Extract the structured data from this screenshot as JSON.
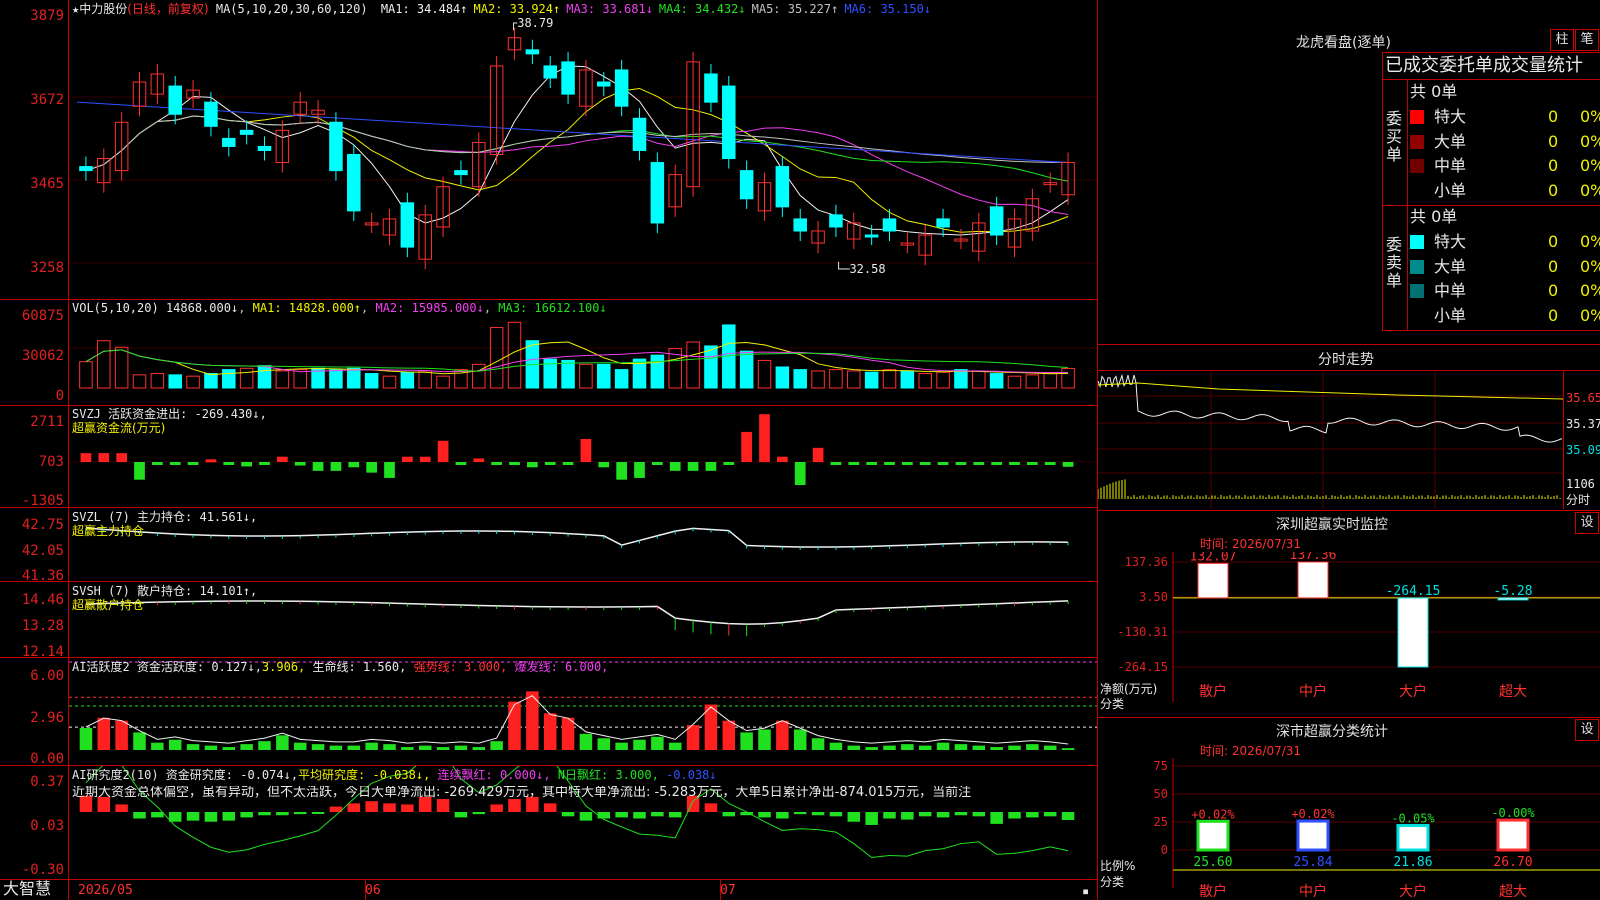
{
  "app": {
    "brand": "大智慧",
    "star": "★",
    "timeline": [
      "2026/05",
      "06",
      "07"
    ]
  },
  "kline": {
    "stock": "中力股份",
    "mode": "(日线，前复权)",
    "ma_def": "MA(5,10,20,30,60,120)",
    "ma_values": [
      {
        "label": "MA1:",
        "value": "34.484↑",
        "color": "#f0f0f0"
      },
      {
        "label": "MA2:",
        "value": "33.924↑",
        "color": "#f0f000"
      },
      {
        "label": "MA3:",
        "value": "33.681↓",
        "color": "#f040f0"
      },
      {
        "label": "MA4:",
        "value": "34.432↓",
        "color": "#20e020"
      },
      {
        "label": "MA5:",
        "value": "35.227↑",
        "color": "#c0c0c0"
      },
      {
        "label": "MA6:",
        "value": "35.150↓",
        "color": "#3050ff"
      }
    ],
    "y_ticks": [
      "3879",
      "3672",
      "3465",
      "3258"
    ],
    "high_mark": "38.79",
    "low_mark": "32.58"
  },
  "vol": {
    "title": "VOL(5,10,20)",
    "value": "14868.000↓",
    "ma1": "14828.000↑",
    "ma2": "15985.000↓",
    "ma3": "16612.100↓",
    "y_ticks": [
      "60875",
      "30062",
      "0"
    ]
  },
  "svzj": {
    "title": "SVZJ  活跃资金进出: -269.430↓,",
    "sub": "超赢资金流(万元)",
    "y_ticks": [
      "2711",
      "703",
      "-1305"
    ]
  },
  "svzl": {
    "title": "SVZL (7) 主力持仓: 41.561↓,",
    "sub": "超赢主力持仓",
    "y_ticks": [
      "42.75",
      "42.05",
      "41.36"
    ]
  },
  "svsh": {
    "title": "SVSH (7) 散户持仓: 14.101↑,",
    "sub": "超赢散户持仓",
    "y_ticks": [
      "14.46",
      "13.28",
      "12.14"
    ]
  },
  "ai2": {
    "title": "AI活跃度2 资金活跃度: 0.127↓,",
    "v2": "3.906,",
    "life": "生命线: 1.560,",
    "strong": "强势线: 3.000,",
    "burst": "爆发线: 6.000,",
    "y_ticks": [
      "6.00",
      "2.96",
      "0.00"
    ]
  },
  "ai_r": {
    "title": "AI研究度2(10) 资金研究度: -0.074↓,",
    "avg": "平均研究度: -0.038↓,",
    "cont": "连续飘红: 0.000↓,",
    "nday": "N日飘红: 3.000,",
    "nday2": "-0.038↓",
    "desc": "近期大资金总体偏空，虽有异动，但不太活跃，今日大单净流出: -269.429万元，其中特大单净流出: -5.283万元，大单5日累计净出-874.015万元，当前注",
    "y_ticks": [
      "0.37",
      "0.03",
      "-0.30"
    ]
  },
  "lhb": {
    "title": "龙虎看盘(逐单)",
    "btn1": "柱",
    "btn2": "笔",
    "header": "已成交委托单成交量统计",
    "buy_label": "委买单",
    "sell_label": "委卖单",
    "buy_total": "共 0单",
    "sell_total": "共 0单",
    "buy_rows": [
      {
        "name": "特大",
        "count": "0",
        "pct": "0%",
        "color": "#ff0000"
      },
      {
        "name": "大单",
        "count": "0",
        "pct": "0%",
        "color": "#900000"
      },
      {
        "name": "中单",
        "count": "0",
        "pct": "0%",
        "color": "#700000"
      },
      {
        "name": "小单",
        "count": "0",
        "pct": "0%",
        "color": "#000000"
      }
    ],
    "sell_rows": [
      {
        "name": "特大",
        "count": "0",
        "pct": "0%",
        "color": "#00ffff"
      },
      {
        "name": "大单",
        "count": "0",
        "pct": "0%",
        "color": "#008b8b"
      },
      {
        "name": "中单",
        "count": "0",
        "pct": "0%",
        "color": "#007070"
      },
      {
        "name": "小单",
        "count": "0",
        "pct": "0%",
        "color": "#000000"
      }
    ]
  },
  "intraday": {
    "title": "分时走势",
    "prices": [
      "35.65",
      "35.37",
      "35.09"
    ],
    "vol_label": "1106",
    "vol_unit": "分时"
  },
  "monitor": {
    "title": "深圳超赢实时监控",
    "btn": "设",
    "time_label": "时间: 2026/07/31",
    "y_ticks": [
      "137.36",
      "3.50",
      "-130.31",
      "-264.15"
    ],
    "y_unit": "净额(万元)",
    "x_unit": "分类",
    "cats": [
      "散户",
      "中户",
      "大户",
      "超大"
    ],
    "values": [
      "132.07",
      "137.36",
      "-264.15",
      "-5.28"
    ]
  },
  "classify": {
    "title": "深市超赢分类统计",
    "btn": "设",
    "time_label": "时间: 2026/07/31",
    "y_ticks": [
      "75",
      "50",
      "25",
      "0"
    ],
    "y_unit": "比例%",
    "x_unit": "分类",
    "cats": [
      "散户",
      "中户",
      "大户",
      "超大"
    ],
    "pcts": [
      "+0.02%",
      "+0.02%",
      "-0.05%",
      "-0.00%"
    ],
    "vals": [
      "25.60",
      "25.84",
      "21.86",
      "26.70"
    ]
  },
  "chart_data": [
    {
      "type": "candlestick",
      "title": "中力股份 (日线，前复权)",
      "y_ticks": [
        3879,
        3672,
        3465,
        3258
      ],
      "close": [
        34.9,
        35.2,
        36.1,
        37.1,
        37.3,
        36.3,
        36.9,
        36.0,
        35.5,
        35.8,
        35.4,
        35.9,
        36.6,
        36.4,
        34.9,
        33.9,
        33.6,
        33.7,
        33.0,
        33.8,
        34.5,
        34.8,
        35.6,
        37.5,
        38.2,
        37.8,
        37.2,
        36.8,
        37.4,
        37.0,
        36.5,
        35.4,
        33.6,
        34.8,
        37.6,
        36.6,
        35.2,
        34.2,
        34.6,
        34.0,
        33.4,
        33.4,
        33.5,
        33.6,
        33.3,
        33.4,
        33.1,
        33.3,
        33.5,
        33.2,
        33.6,
        33.3,
        33.7,
        34.2,
        34.6,
        35.1
      ]
    },
    {
      "type": "bar",
      "title": "VOL(5,10,20)",
      "values": [
        20000,
        36000,
        31000,
        10000,
        11000,
        10000,
        9000,
        11000,
        14000,
        15000,
        17000,
        13000,
        14000,
        15000,
        14000,
        15000,
        11000,
        9000,
        12000,
        13000,
        9000,
        14000,
        18000,
        46000,
        50000,
        36000,
        22000,
        21000,
        18000,
        18000,
        14000,
        22000,
        25000,
        30000,
        35000,
        32000,
        48000,
        28000,
        21000,
        16000,
        14000,
        13000,
        14000,
        13000,
        12000,
        14000,
        13000,
        11000,
        12000,
        14000,
        13000,
        11000,
        9000,
        10000,
        11000,
        14868
      ]
    },
    {
      "type": "bar",
      "title": "超赢资金流(万元)",
      "values": [
        500,
        500,
        500,
        -1000,
        -80,
        -80,
        -80,
        150,
        -80,
        -250,
        -80,
        300,
        -200,
        -500,
        -500,
        -300,
        -600,
        -900,
        300,
        300,
        1200,
        -80,
        200,
        -80,
        -80,
        -300,
        -80,
        -80,
        1300,
        -300,
        -1000,
        -900,
        -80,
        -500,
        -500,
        -500,
        -80,
        1700,
        2700,
        300,
        -1300,
        800,
        -80,
        -80,
        -80,
        -80,
        -80,
        -80,
        -80,
        -80,
        -80,
        -80,
        -80,
        -80,
        -80,
        -270
      ]
    },
    {
      "type": "line",
      "title": "超赢主力持仓",
      "y_ticks": [
        42.75,
        42.05,
        41.36
      ]
    },
    {
      "type": "line",
      "title": "超赢散户持仓",
      "y_ticks": [
        14.46,
        13.28,
        12.14
      ]
    },
    {
      "type": "bar",
      "title": "AI活跃度2",
      "y_ticks": [
        6.0,
        2.96,
        0.0
      ],
      "values": [
        1.5,
        2.2,
        2.0,
        1.2,
        0.5,
        0.7,
        0.4,
        0.3,
        0.2,
        0.4,
        0.6,
        1.0,
        0.5,
        0.4,
        0.3,
        0.3,
        0.5,
        0.4,
        0.2,
        0.3,
        0.2,
        0.3,
        0.2,
        0.6,
        3.3,
        4.0,
        2.5,
        2.2,
        1.1,
        0.8,
        0.5,
        0.7,
        0.9,
        0.5,
        1.7,
        3.1,
        2.0,
        1.2,
        1.4,
        2.0,
        1.4,
        0.8,
        0.5,
        0.3,
        0.2,
        0.3,
        0.4,
        0.3,
        0.5,
        0.4,
        0.3,
        0.2,
        0.3,
        0.4,
        0.3,
        0.127
      ]
    },
    {
      "type": "bar",
      "title": "AI研究度2(10)",
      "y_ticks": [
        0.37,
        0.03,
        -0.3
      ],
      "values": [
        0.15,
        0.14,
        0.07,
        -0.06,
        -0.05,
        -0.09,
        -0.08,
        -0.09,
        -0.08,
        -0.05,
        -0.03,
        -0.03,
        -0.02,
        -0.01,
        0.05,
        0.08,
        0.1,
        0.08,
        0.07,
        0.14,
        0.12,
        -0.05,
        -0.02,
        0.07,
        0.12,
        0.14,
        0.08,
        -0.04,
        -0.08,
        -0.06,
        -0.05,
        -0.06,
        -0.04,
        -0.05,
        0.15,
        0.08,
        -0.04,
        -0.03,
        -0.05,
        -0.06,
        -0.02,
        -0.03,
        -0.04,
        -0.09,
        -0.12,
        -0.06,
        -0.07,
        -0.04,
        -0.05,
        -0.03,
        -0.04,
        -0.11,
        -0.06,
        -0.05,
        -0.04,
        -0.074
      ]
    },
    {
      "type": "bar",
      "title": "深圳超赢实时监控",
      "categories": [
        "散户",
        "中户",
        "大户",
        "超大"
      ],
      "values": [
        132.07,
        137.36,
        -264.15,
        -5.28
      ]
    },
    {
      "type": "bar",
      "title": "深市超赢分类统计",
      "categories": [
        "散户",
        "中户",
        "大户",
        "超大"
      ],
      "values": [
        25.6,
        25.84,
        21.86,
        26.7
      ]
    }
  ]
}
